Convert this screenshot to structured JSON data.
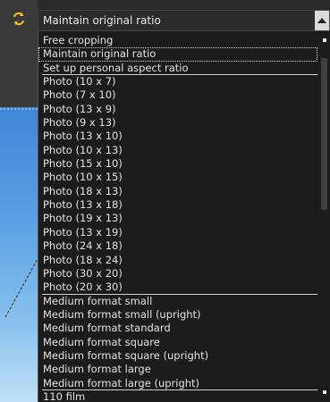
{
  "combo": {
    "value": "Maintain original ratio",
    "arrow_icon": "triangle-up-icon"
  },
  "toolbar": {
    "icon": "swap-arrows-icon",
    "icon_color": "#f0c020"
  },
  "colors": {
    "list_background": "#1c1c1c",
    "text": "#e2e2e2",
    "separator": "#d0d0d0"
  },
  "dropdown": {
    "items": [
      {
        "label": "Free cropping"
      },
      {
        "label": "Maintain original ratio",
        "selected": true
      },
      {
        "label": "Set up personal aspect ratio",
        "separator_after": true
      },
      {
        "label": "Photo (10 x 7)"
      },
      {
        "label": "Photo (7 x 10)"
      },
      {
        "label": "Photo (13 x 9)"
      },
      {
        "label": "Photo (9 x 13)"
      },
      {
        "label": "Photo (13 x 10)"
      },
      {
        "label": "Photo (10 x 13)"
      },
      {
        "label": "Photo (15 x 10)"
      },
      {
        "label": "Photo (10 x 15)"
      },
      {
        "label": "Photo (18 x 13)"
      },
      {
        "label": "Photo (13 x 18)"
      },
      {
        "label": "Photo (19 x 13)"
      },
      {
        "label": "Photo (13 x 19)"
      },
      {
        "label": "Photo (24 x 18)"
      },
      {
        "label": "Photo (18 x 24)"
      },
      {
        "label": "Photo (30 x 20)"
      },
      {
        "label": "Photo (20 x 30)",
        "separator_after": true
      },
      {
        "label": "Medium format small"
      },
      {
        "label": "Medium format small (upright)"
      },
      {
        "label": "Medium format standard"
      },
      {
        "label": "Medium format square"
      },
      {
        "label": "Medium format square (upright)"
      },
      {
        "label": "Medium format large"
      },
      {
        "label": "Medium format large (upright)",
        "separator_after": true
      },
      {
        "label": "110 film"
      }
    ]
  }
}
